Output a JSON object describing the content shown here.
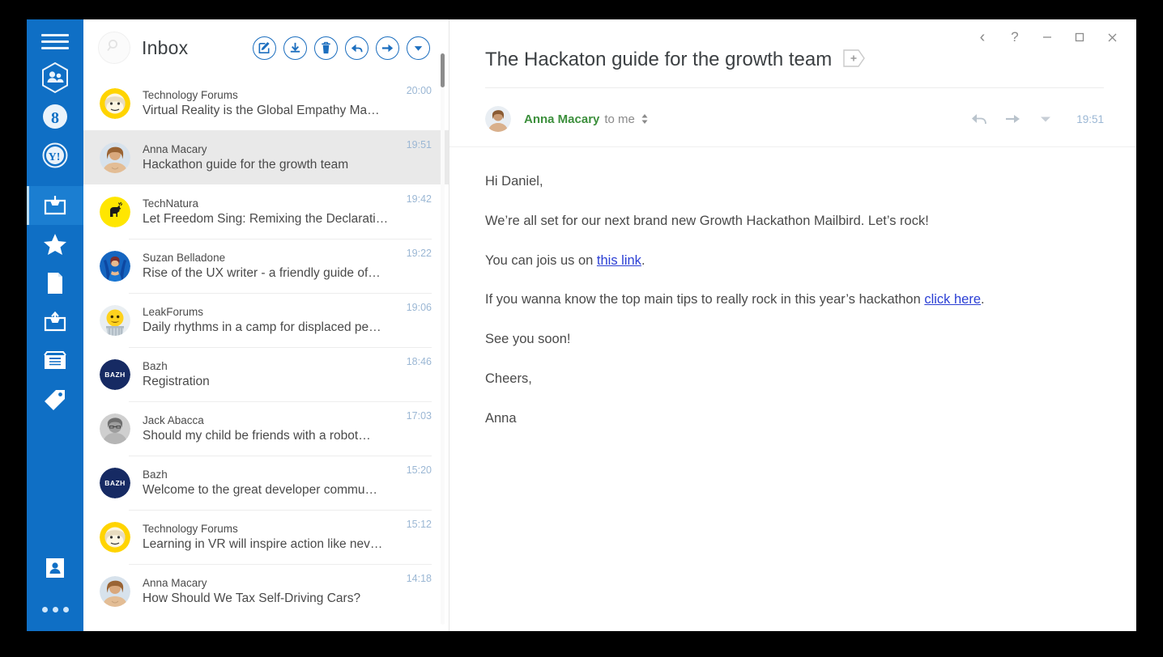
{
  "sidebar": {
    "menu_icon": "hamburger-icon",
    "accounts": [
      {
        "name": "contacts-hex-icon",
        "label": "Contacts"
      },
      {
        "name": "google-icon",
        "label": "Google"
      },
      {
        "name": "yahoo-icon",
        "label": "Yahoo"
      }
    ],
    "folders": [
      {
        "name": "inbox-icon",
        "label": "Inbox",
        "selected": true
      },
      {
        "name": "star-icon",
        "label": "Starred",
        "selected": false
      },
      {
        "name": "drafts-icon",
        "label": "Drafts",
        "selected": false
      },
      {
        "name": "sent-icon",
        "label": "Sent",
        "selected": false
      },
      {
        "name": "archive-icon",
        "label": "Archive",
        "selected": false
      },
      {
        "name": "tag-icon",
        "label": "Labels",
        "selected": false
      }
    ],
    "bottom": [
      {
        "name": "contacts-card-icon",
        "label": "Contacts"
      },
      {
        "name": "more-dots-icon",
        "label": "More"
      }
    ]
  },
  "list": {
    "search_placeholder": "Search",
    "folder_title": "Inbox",
    "toolbar": [
      {
        "name": "compose-button",
        "label": "Compose"
      },
      {
        "name": "archive-button",
        "label": "Archive"
      },
      {
        "name": "delete-button",
        "label": "Delete"
      },
      {
        "name": "reply-button",
        "label": "Reply"
      },
      {
        "name": "forward-button",
        "label": "Forward"
      },
      {
        "name": "more-button",
        "label": "More"
      }
    ],
    "items": [
      {
        "from": "Technology Forums",
        "subject": "Virtual Reality is the Global Empathy Ma…",
        "time": "20:00",
        "avatar": "face-yellow",
        "selected": false
      },
      {
        "from": "Anna Macary",
        "subject": "Hackathon guide for the growth team",
        "time": "19:51",
        "avatar": "photo-anna",
        "selected": true
      },
      {
        "from": "TechNatura",
        "subject": "Let Freedom Sing: Remixing the Declarati…",
        "time": "19:42",
        "avatar": "deer-yellow",
        "selected": false
      },
      {
        "from": "Suzan Belladone",
        "subject": "Rise of the UX writer - a friendly guide of…",
        "time": "19:22",
        "avatar": "figure-blue",
        "selected": false
      },
      {
        "from": "LeakForums",
        "subject": "Daily rhythms in a camp for displaced pe…",
        "time": "19:06",
        "avatar": "emoji-yellow",
        "selected": false
      },
      {
        "from": "Bazh",
        "subject": "Registration",
        "time": "18:46",
        "avatar": "bazh-navy",
        "initials": "BAZH",
        "selected": false
      },
      {
        "from": "Jack Abacca",
        "subject": "Should my child be friends with a robot…",
        "time": "17:03",
        "avatar": "photo-gray",
        "selected": false
      },
      {
        "from": "Bazh",
        "subject": "Welcome to the great developer commu…",
        "time": "15:20",
        "avatar": "bazh-navy",
        "initials": "BAZH",
        "selected": false
      },
      {
        "from": "Technology Forums",
        "subject": "Learning in VR will inspire action like nev…",
        "time": "15:12",
        "avatar": "face-yellow",
        "selected": false
      },
      {
        "from": "Anna Macary",
        "subject": "How Should We Tax Self-Driving Cars?",
        "time": "14:18",
        "avatar": "photo-anna",
        "selected": false
      }
    ]
  },
  "window_controls": [
    {
      "name": "back-button",
      "glyph": "‹"
    },
    {
      "name": "help-button",
      "glyph": "?"
    },
    {
      "name": "minimize-button",
      "glyph": "–"
    },
    {
      "name": "maximize-button",
      "glyph": "☐"
    },
    {
      "name": "close-button",
      "glyph": "✕"
    }
  ],
  "reader": {
    "title": "The Hackaton guide for the growth team",
    "add_tag_label": "Add tag",
    "sender_name": "Anna Macary",
    "sender_to": "to me",
    "time": "19:51",
    "actions": [
      {
        "name": "reply-button",
        "label": "Reply"
      },
      {
        "name": "forward-button",
        "label": "Forward"
      },
      {
        "name": "more-button",
        "label": "More"
      }
    ],
    "body": {
      "greeting": "Hi Daniel,",
      "p1": "We’re all set for our next brand new Growth Hackathon Mailbird. Let’s rock!",
      "p2_before": "You can jois us on ",
      "p2_link": "this link",
      "p2_after": ".",
      "p3_before": "If you wanna know the top main tips to really rock in this year’s hackathon ",
      "p3_link": "click here",
      "p3_after": ".",
      "p4": "See you soon!",
      "p5": "Cheers,",
      "p6": "Anna"
    }
  },
  "colors": {
    "sidebar": "#0f6fc5",
    "sidebar_selected": "#1b7ed1",
    "accent": "#1d6fbf",
    "selected_row": "#e9e9e9",
    "link": "#2b3fd4",
    "sender_name": "#3c8f3c",
    "time": "#9bb7d4"
  }
}
